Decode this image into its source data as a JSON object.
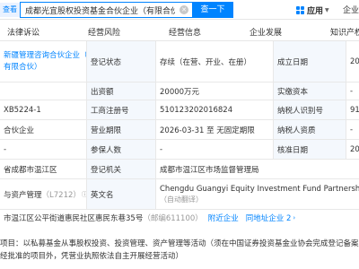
{
  "topbar": {
    "left_tag": "查看",
    "search_value": "成都光宜股权投资基金合伙企业（有限合伙）",
    "search_button": "查一下",
    "app_label": "应用",
    "company_label": "企业"
  },
  "tabs": [
    "法律诉讼",
    "经营风险",
    "经营信息",
    "企业发展",
    "知识产权"
  ],
  "rows": {
    "r1": {
      "a": "新疆管理咨询合伙企业（",
      "b": "有限合伙）",
      "l1": "登记状态",
      "v1": "存续（在营、开业、在册）",
      "l2": "成立日期",
      "v2": "20"
    },
    "r2": {
      "l1": "出资额",
      "v1": "20000万元",
      "l2": "实缴资本",
      "v2": "-"
    },
    "r3": {
      "a": "XB5224-1",
      "l1": "工商注册号",
      "v1": "510123202016824",
      "l2": "纳税人识别号",
      "v2": "91"
    },
    "r4": {
      "a": "合伙企业",
      "l1": "营业期限",
      "v1": "2026-03-31 至 无固定期限",
      "l2": "纳税人资质",
      "v2": "-"
    },
    "r5": {
      "a": "-",
      "l1": "参保人数",
      "v1": "-",
      "l2": "核准日期",
      "v2": "20"
    },
    "r6": {
      "a": "省成都市温江区",
      "l1": "登记机关",
      "v1": "成都市温江区市场监督管理局"
    },
    "r7": {
      "a": "与资产管理",
      "a_code": "（L7212）",
      "l1": "英文名",
      "v1": "Chengdu Guangyi Equity Investment Fund Partnership En",
      "v1b": "（自动翻译）"
    },
    "r8": {
      "a": "市温江区公平街道惠民社区惠民东巷35号",
      "a_code": "（邮编611100）",
      "link1": "附近企业",
      "link2": "同地址企业 2"
    }
  },
  "business_scope": {
    "line1": "项目：以私募基金从事股权投资、投资管理、资产管理等活动（须在中国证券投资基金业协会完成登记备案后方",
    "line2": "经批准的项目外，凭营业执照依法自主开展经营活动）"
  },
  "colors": {
    "accent": "#0084ff",
    "label_bg": "#f4f8fd",
    "border": "#e8e8e8"
  }
}
